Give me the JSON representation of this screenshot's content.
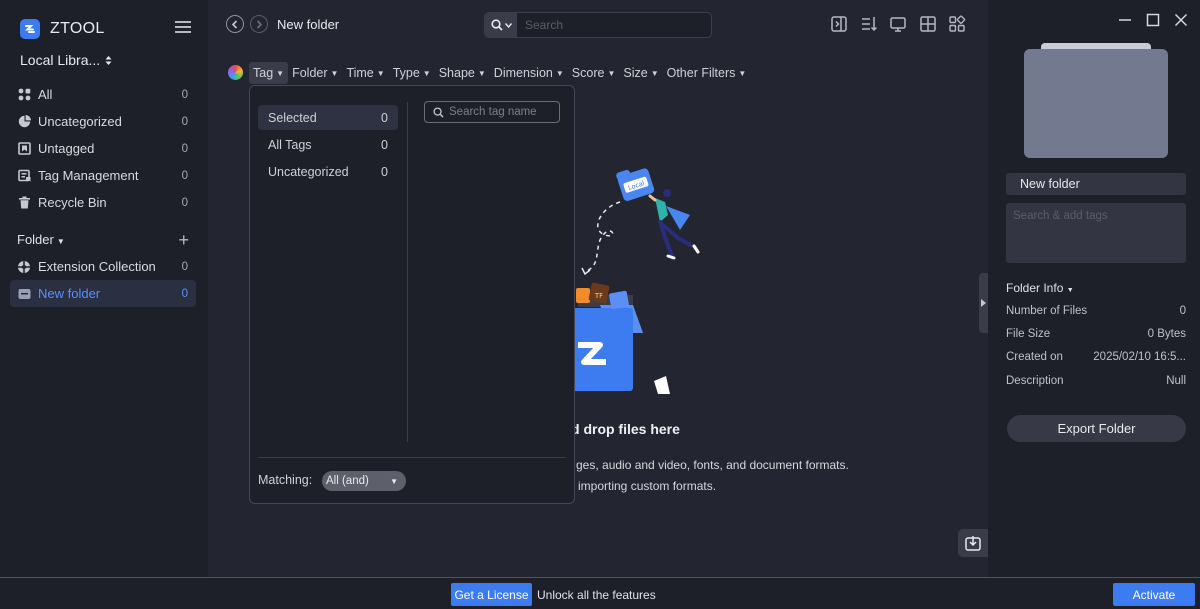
{
  "app": {
    "name": "ZTOOL",
    "library": "Local Libra..."
  },
  "sidebar": {
    "items": [
      {
        "label": "All",
        "count": "0"
      },
      {
        "label": "Uncategorized",
        "count": "0"
      },
      {
        "label": "Untagged",
        "count": "0"
      },
      {
        "label": "Tag Management",
        "count": "0"
      },
      {
        "label": "Recycle Bin",
        "count": "0"
      }
    ],
    "folder_title": "Folder",
    "folders": [
      {
        "label": "Extension Collection",
        "count": "0"
      },
      {
        "label": "New folder",
        "count": "0"
      }
    ]
  },
  "toolbar": {
    "title": "New folder",
    "search_placeholder": "Search"
  },
  "filters": [
    "Tag",
    "Folder",
    "Time",
    "Type",
    "Shape",
    "Dimension",
    "Score",
    "Size",
    "Other Filters"
  ],
  "tag_dropdown": {
    "items": [
      {
        "label": "Selected",
        "count": "0"
      },
      {
        "label": "All Tags",
        "count": "0"
      },
      {
        "label": "Uncategorized",
        "count": "0"
      }
    ],
    "search_placeholder": "Search tag name",
    "matching_label": "Matching:",
    "matching_value": "All (and)"
  },
  "empty_state": {
    "title": "d drop files here",
    "line1": "ges, audio and video, fonts, and document formats.",
    "line2": "importing custom formats."
  },
  "details": {
    "name": "New folder",
    "tags_placeholder": "Search & add tags",
    "info_title": "Folder Info",
    "rows": [
      {
        "label": "Number of Files",
        "value": "0"
      },
      {
        "label": "File Size",
        "value": "0 Bytes"
      },
      {
        "label": "Created on",
        "value": "2025/02/10 16:5..."
      },
      {
        "label": "Description",
        "value": "Null"
      }
    ],
    "export_label": "Export Folder"
  },
  "footer": {
    "license": "Get a License",
    "unlock": "Unlock all the features",
    "activate": "Activate"
  },
  "colors": {
    "accent": "#3d7bf0",
    "bg": "#232530",
    "panel": "#1d1f29"
  }
}
